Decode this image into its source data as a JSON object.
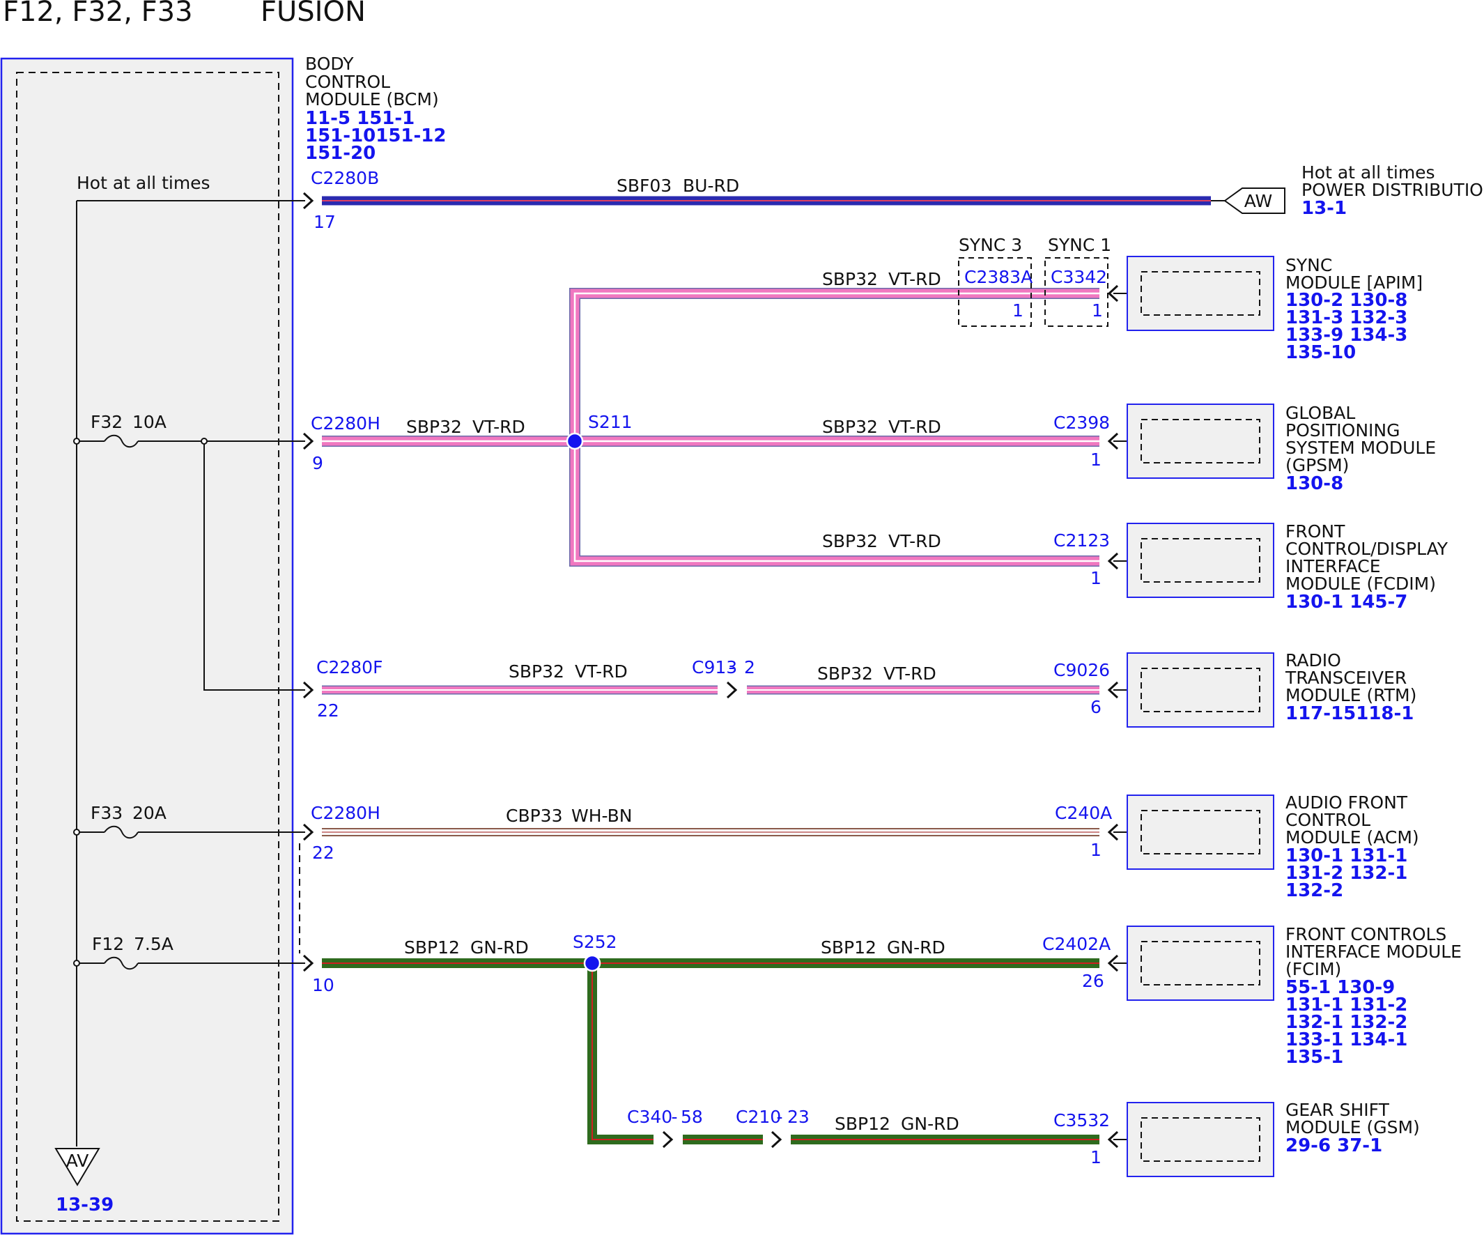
{
  "header": {
    "fuses": "F12, F32, F33",
    "vehicle": "FUSION"
  },
  "colors": {
    "module_border": "#2222ee",
    "module_fill": "#f0f0f0",
    "splice": "#1414ee",
    "wire_bu_rd": "#2a2ab0",
    "wire_vt_rd": "#f078c0",
    "wire_wh_bn": "#b07060",
    "wire_gn_rd": "#2e6b1e"
  },
  "bcm": {
    "name": [
      "BODY",
      "CONTROL",
      "MODULE (BCM)"
    ],
    "refs": [
      "11-5   151-1",
      "151-10151-12",
      "151-20"
    ],
    "hot_label": "Hot at all times",
    "ground": {
      "label": "AV",
      "ref": "13-39"
    }
  },
  "power_dist": {
    "lines": [
      "Hot at all times",
      "POWER DISTRIBUTION"
    ],
    "connector": "AW",
    "ref": "13-1"
  },
  "fuses": [
    {
      "id": "F32",
      "rating": "10A"
    },
    {
      "id": "F33",
      "rating": "20A"
    },
    {
      "id": "F12",
      "rating": "7.5A"
    }
  ],
  "sync_variants": [
    "SYNC 3",
    "SYNC 1"
  ],
  "connectors": {
    "bcm_c2280b": {
      "name": "C2280B",
      "pin": "17"
    },
    "bcm_c2280h_f32": {
      "name": "C2280H",
      "pin": "9"
    },
    "bcm_c2280f": {
      "name": "C2280F",
      "pin": "22"
    },
    "bcm_c2280h_f33": {
      "name": "C2280H",
      "pin": "22"
    },
    "bcm_f12": {
      "pin": "10"
    },
    "c2383a": {
      "name": "C2383A",
      "pin": "1"
    },
    "c3342": {
      "name": "C3342",
      "pin": "1"
    },
    "c2398": {
      "name": "C2398",
      "pin": "1"
    },
    "c2123": {
      "name": "C2123",
      "pin": "1"
    },
    "c913": {
      "name": "C913",
      "pin": "2"
    },
    "c9026": {
      "name": "C9026",
      "pin": "6"
    },
    "c240a": {
      "name": "C240A",
      "pin": "1"
    },
    "c2402a": {
      "name": "C2402A",
      "pin": "26"
    },
    "c340": {
      "name": "C340",
      "pin": "58"
    },
    "c210": {
      "name": "C210",
      "pin": "23"
    },
    "c3532": {
      "name": "C3532",
      "pin": "1"
    }
  },
  "splices": {
    "s211": "S211",
    "s252": "S252"
  },
  "wires": {
    "sbf03": {
      "circuit": "SBF03",
      "color": "BU-RD"
    },
    "sbp32": {
      "circuit": "SBP32",
      "color": "VT-RD"
    },
    "cbp33": {
      "circuit": "CBP33",
      "color": "WH-BN"
    },
    "sbp12": {
      "circuit": "SBP12",
      "color": "GN-RD"
    }
  },
  "modules": {
    "apim": {
      "lines": [
        "SYNC",
        "MODULE [APIM]"
      ],
      "refs": [
        "130-2 130-8",
        "131-3 132-3",
        "133-9 134-3",
        "135-10"
      ]
    },
    "gpsm": {
      "lines": [
        "GLOBAL",
        "POSITIONING",
        "SYSTEM MODULE",
        "(GPSM)"
      ],
      "refs": [
        "130-8"
      ]
    },
    "fcdim": {
      "lines": [
        "FRONT",
        "CONTROL/DISPLAY",
        "INTERFACE",
        "MODULE (FCDIM)"
      ],
      "refs": [
        "130-1 145-7"
      ]
    },
    "rtm": {
      "lines": [
        "RADIO",
        "TRANSCEIVER",
        "MODULE (RTM)"
      ],
      "refs": [
        "117-15118-1"
      ]
    },
    "acm": {
      "lines": [
        "AUDIO FRONT",
        "CONTROL",
        "MODULE (ACM)"
      ],
      "refs": [
        "130-1 131-1",
        "131-2 132-1",
        "132-2"
      ]
    },
    "fcim": {
      "lines": [
        "FRONT CONTROLS",
        "INTERFACE MODULE",
        "(FCIM)"
      ],
      "refs": [
        "55-1   130-9",
        "131-1 131-2",
        "132-1 132-2",
        "133-1 134-1",
        "135-1"
      ]
    },
    "gsm": {
      "lines": [
        "GEAR SHIFT",
        "MODULE (GSM)"
      ],
      "refs": [
        "29-6   37-1"
      ]
    }
  }
}
